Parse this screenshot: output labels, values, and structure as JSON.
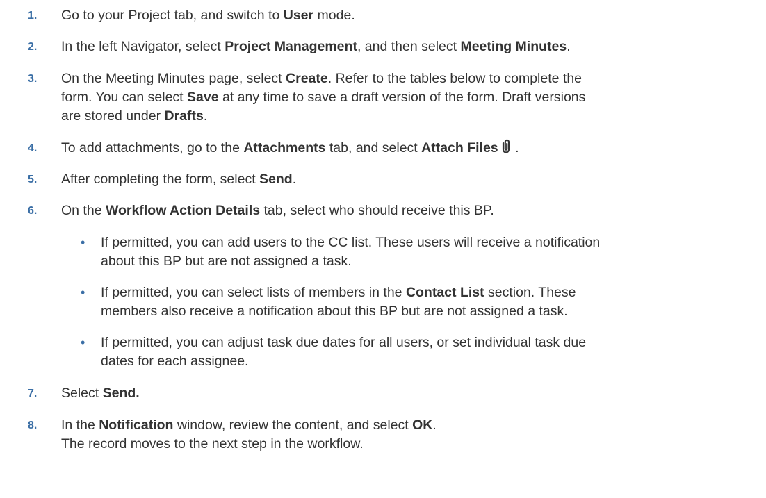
{
  "steps": [
    {
      "num": "1.",
      "parts": [
        {
          "t": "Go to your Project tab, and switch to "
        },
        {
          "b": "User"
        },
        {
          "t": " mode."
        }
      ]
    },
    {
      "num": "2.",
      "parts": [
        {
          "t": "In the left Navigator, select "
        },
        {
          "b": "Project Management"
        },
        {
          "t": ", and then select "
        },
        {
          "b": "Meeting Minutes"
        },
        {
          "t": "."
        }
      ]
    },
    {
      "num": "3.",
      "lines": [
        [
          {
            "t": "On the Meeting Minutes page, select "
          },
          {
            "b": "Create"
          },
          {
            "t": ". Refer to the tables below to complete the"
          }
        ],
        [
          {
            "t": "form. You can select "
          },
          {
            "b": "Save"
          },
          {
            "t": " at any time to save a draft version of the form. Draft versions"
          }
        ],
        [
          {
            "t": "are stored under "
          },
          {
            "b": "Drafts"
          },
          {
            "t": "."
          }
        ]
      ]
    },
    {
      "num": "4.",
      "parts": [
        {
          "t": "To add attachments, go to the "
        },
        {
          "b": "Attachments"
        },
        {
          "t": " tab, and select "
        },
        {
          "b": "Attach Files"
        },
        {
          "icon": "paperclip-icon"
        },
        {
          "t": " ."
        }
      ]
    },
    {
      "num": "5.",
      "parts": [
        {
          "t": "After completing the form, select "
        },
        {
          "b": "Send"
        },
        {
          "t": "."
        }
      ]
    },
    {
      "num": "6.",
      "parts": [
        {
          "t": "On the "
        },
        {
          "b": "Workflow Action Details"
        },
        {
          "t": " tab, select who should receive this BP."
        }
      ]
    },
    {
      "num": "7.",
      "parts": [
        {
          "t": "Select "
        },
        {
          "b": "Send."
        }
      ]
    },
    {
      "num": "8.",
      "lines": [
        [
          {
            "t": "In the "
          },
          {
            "b": "Notification"
          },
          {
            "t": " window, review the content, and select "
          },
          {
            "b": "OK"
          },
          {
            "t": "."
          }
        ],
        [
          {
            "t": "The record moves to the next step in the workflow."
          }
        ]
      ]
    }
  ],
  "substeps": [
    {
      "bullet": "•",
      "lines": [
        [
          {
            "t": "If permitted, you can add users to the CC list. These users will receive a notification"
          }
        ],
        [
          {
            "t": "about this BP but are not assigned a task."
          }
        ]
      ]
    },
    {
      "bullet": "•",
      "lines": [
        [
          {
            "t": "If permitted, you can select lists of members in the "
          },
          {
            "b": "Contact List"
          },
          {
            "t": " section. These"
          }
        ],
        [
          {
            "t": "members also receive a notification about this BP but are not assigned a task."
          }
        ]
      ]
    },
    {
      "bullet": "•",
      "lines": [
        [
          {
            "t": "If permitted, you can adjust task due dates for all users, or set individual task due"
          }
        ],
        [
          {
            "t": "dates for each assignee."
          }
        ]
      ]
    }
  ],
  "colors": {
    "number": "#3a6ea5",
    "text": "#333333"
  }
}
